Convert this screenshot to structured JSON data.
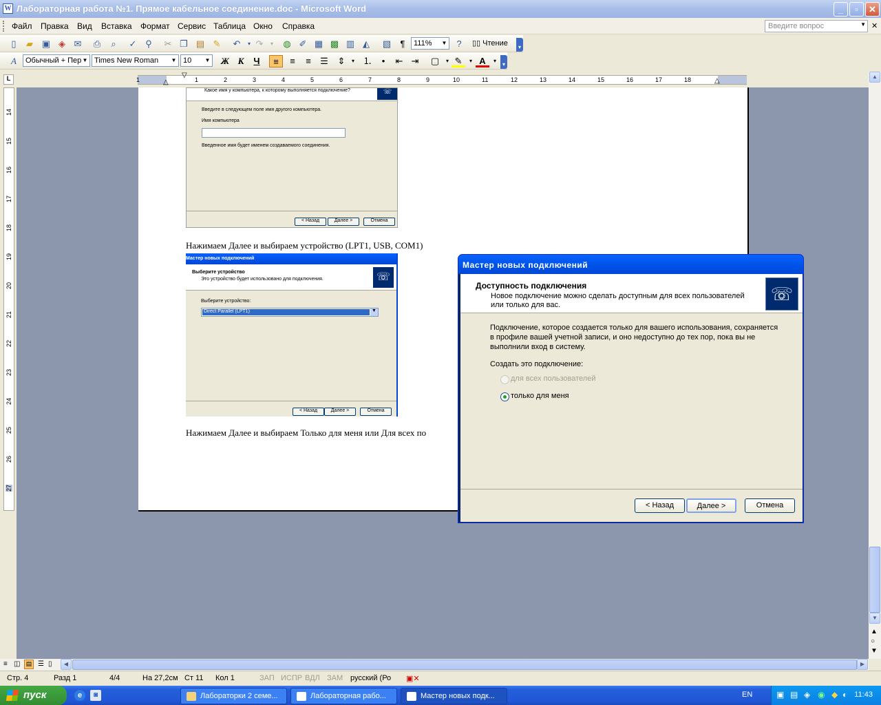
{
  "window": {
    "title": "Лабораторная работа №1. Прямое кабельное соединение.doc - Microsoft Word",
    "app_icon": "W"
  },
  "menu": {
    "items": [
      "Файл",
      "Правка",
      "Вид",
      "Вставка",
      "Формат",
      "Сервис",
      "Таблица",
      "Окно",
      "Справка"
    ],
    "ask_placeholder": "Введите вопрос"
  },
  "toolbar": {
    "zoom": "111%",
    "reading_label": "Чтение",
    "style": "Обычный + Пер",
    "font": "Times New Roman",
    "size": "10",
    "bold": "Ж",
    "italic": "К",
    "underline": "Ч"
  },
  "ruler": {
    "numbers": [
      "1",
      "1",
      "2",
      "3",
      "4",
      "5",
      "6",
      "7",
      "8",
      "9",
      "10",
      "11",
      "12",
      "13",
      "14",
      "15",
      "16",
      "17",
      "18"
    ],
    "vnumbers": [
      "14",
      "15",
      "16",
      "17",
      "18",
      "19",
      "20",
      "21",
      "22",
      "23",
      "24",
      "25",
      "26",
      "27"
    ]
  },
  "document": {
    "shot1": {
      "question": "Какое имя у компьютера, к которому выполняется подключение?",
      "prompt": "Введите в следующем поле имя другого компьютера.",
      "field_label": "Имя компьютера",
      "hint": "Введенное имя будет именем создаваемого соединения.",
      "back": "< Назад",
      "next": "Далее >",
      "cancel": "Отмена"
    },
    "para1": "Нажимаем Далее и выбираем устройство (LPT1, USB, COM1)",
    "shot2": {
      "title": "Мастер новых подключений",
      "heading": "Выберите устройство",
      "sub": "Это устройство будет использовано для подключения.",
      "select_label": "Выберите устройство:",
      "select_value": "Direct Parallel (LPT1)",
      "back": "< Назад",
      "next": "Далее >",
      "cancel": "Отмена"
    },
    "para2": "Нажимаем Далее и выбираем Только для меня или Для всех по"
  },
  "wizard": {
    "title": "Мастер новых подключений",
    "heading": "Доступность подключения",
    "subheading_line1": "Новое подключение можно сделать доступным для всех пользователей",
    "subheading_line2": "или только для вас.",
    "desc_line1": "Подключение, которое создается только для вашего использования, сохраняется",
    "desc_line2": "в профиле вашей учетной записи, и оно недоступно до тех пор, пока вы не",
    "desc_line3": "выполнили вход в систему.",
    "create_label": "Создать это подключение:",
    "option_all": "для всех пользователей",
    "option_me": "только для меня",
    "back": "< Назад",
    "next": "Далее >",
    "cancel": "Отмена"
  },
  "status": {
    "page": "Стр. 4",
    "section": "Разд 1",
    "pages": "4/4",
    "at": "На 27,2см",
    "line": "Ст 11",
    "col": "Кол 1",
    "rec": "ЗАП",
    "trk": "ИСПР",
    "ext": "ВДЛ",
    "ovr": "ЗАМ",
    "lang": "русский (Ро"
  },
  "taskbar": {
    "start": "пуск",
    "tasks": [
      "Лабораторки 2 семе...",
      "Лабораторная рабо...",
      "Мастер новых подк..."
    ],
    "lang": "EN",
    "clock": "11:43"
  }
}
